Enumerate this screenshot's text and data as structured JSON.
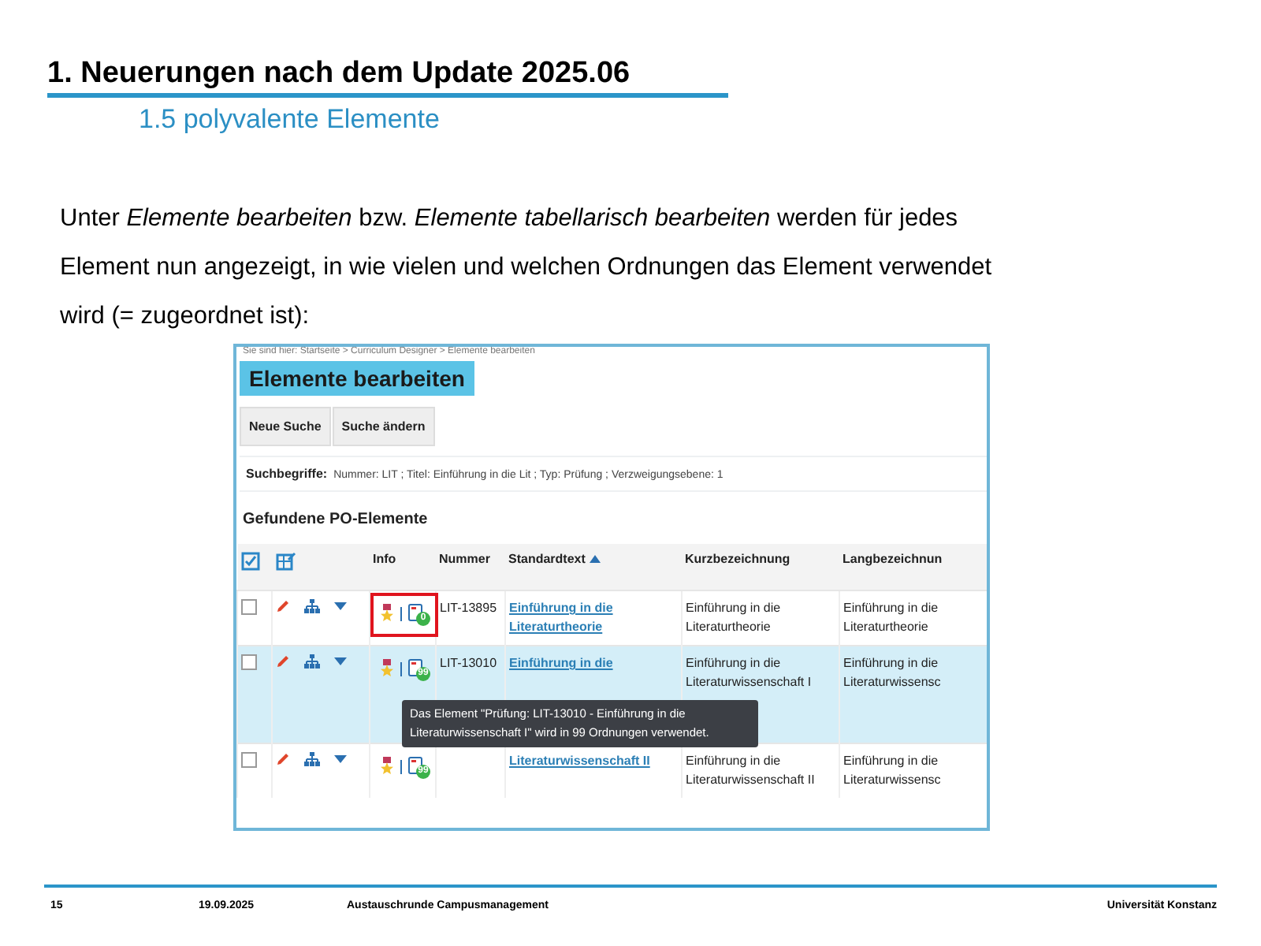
{
  "slide": {
    "title": "1. Neuerungen nach dem Update 2025.06",
    "subtitle": "1.5 polyvalente Elemente",
    "paragraph": "Unter *Elemente bearbeiten* bzw. *Elemente tabellarisch bearbeiten* werden für jedes Element nun angezeigt, in wie vielen und welchen Ordnungen das Element verwendet wird (= zugeordnet ist):"
  },
  "screenshot": {
    "breadcrumb": "Sie sind hier: Startseite > Curriculum Designer > Elemente bearbeiten",
    "page_title": "Elemente bearbeiten",
    "buttons": [
      "Neue Suche",
      "Suche ändern"
    ],
    "search_terms": {
      "label": "Suchbegriffe:",
      "value": "Nummer: LIT ; Titel: Einführung in die Lit ; Typ: Prüfung ; Verzweigungsebene: 1"
    },
    "section_title": "Gefundene PO-Elemente",
    "table": {
      "columns": [
        {
          "label": "Info",
          "sorted": false
        },
        {
          "label": "Nummer",
          "sorted": false
        },
        {
          "label": "Standardtext",
          "sorted": true
        },
        {
          "label": "Kurzbezeichnung",
          "sorted": false
        },
        {
          "label": "Langbezeichnun",
          "sorted": false
        }
      ],
      "rows": [
        {
          "selected": false,
          "checked": false,
          "highlighted": true,
          "usage_count": "0",
          "number": "LIT-13895",
          "standard_text": "Einführung in die Literaturtheorie",
          "short_name": "Einführung in die Literaturtheorie",
          "long_name": "Einführung in die Literaturtheorie"
        },
        {
          "selected": true,
          "checked": false,
          "highlighted": false,
          "usage_count": "99",
          "number": "LIT-13010",
          "standard_text": "Einführung in die",
          "short_name": "Einführung in die Literaturwissenschaft I",
          "long_name": "Einführung in die Literaturwissensc",
          "tooltip": "Das Element \"Prüfung: LIT-13010 - Einführung in die Literaturwissenschaft I\" wird in 99 Ordnungen verwendet."
        },
        {
          "selected": false,
          "checked": false,
          "highlighted": false,
          "usage_count": "99",
          "standard_text": "Literaturwissenschaft II",
          "short_name": "Einführung in die Literaturwissenschaft II",
          "long_name": "Einführung in die Literaturwissensc"
        }
      ]
    }
  },
  "footer": {
    "page": "15",
    "date": "19.09.2025",
    "event": "Austauschrunde Campusmanagement",
    "institution": "Universität Konstanz"
  }
}
